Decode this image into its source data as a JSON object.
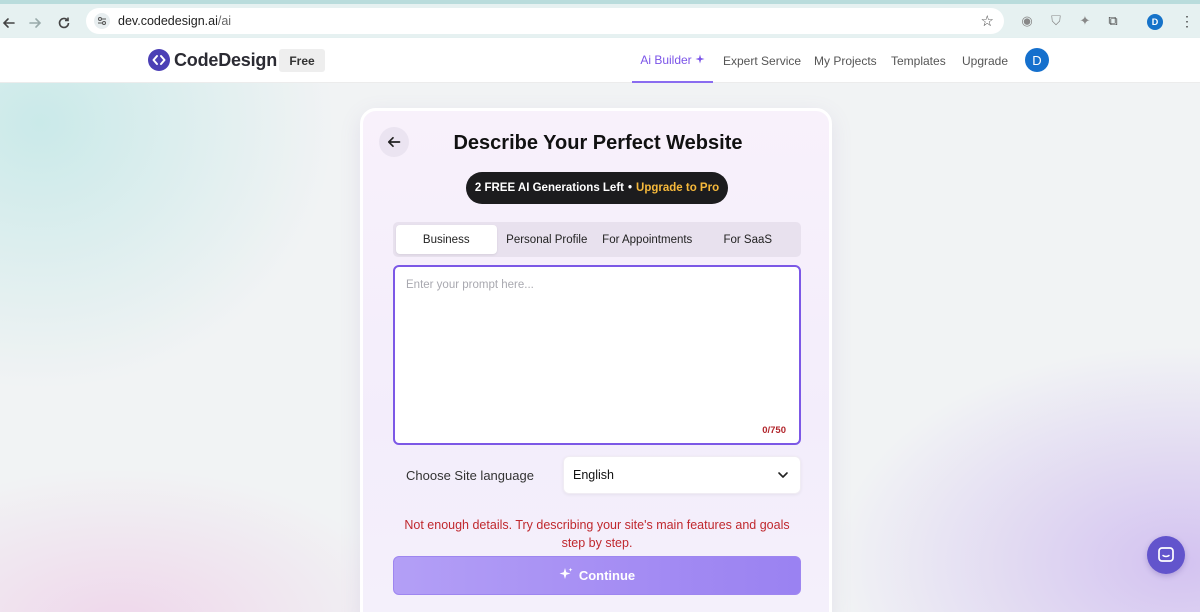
{
  "browser": {
    "url_host": "dev.codedesign.ai",
    "url_path": "/ai"
  },
  "header": {
    "brand": "CodeDesign",
    "plan_badge": "Free",
    "nav": [
      {
        "label": "Ai Builder",
        "active": true
      },
      {
        "label": "Expert Service",
        "active": false
      },
      {
        "label": "My Projects",
        "active": false
      },
      {
        "label": "Templates",
        "active": false
      },
      {
        "label": "Upgrade",
        "active": false
      }
    ],
    "avatar_initial": "D"
  },
  "card": {
    "title": "Describe Your Perfect Website",
    "generations_text": "2 FREE AI Generations Left",
    "generations_sep": "•",
    "upgrade_link": "Upgrade to Pro",
    "tabs": [
      {
        "label": "Business",
        "active": true
      },
      {
        "label": "Personal Profile",
        "active": false
      },
      {
        "label": "For Appointments",
        "active": false
      },
      {
        "label": "For SaaS",
        "active": false
      }
    ],
    "prompt": {
      "placeholder": "Enter your prompt here...",
      "value": "",
      "char_count": "0/750"
    },
    "language": {
      "label": "Choose Site language",
      "selected": "English"
    },
    "error": "Not enough details. Try describing your site's main features and goals step by step.",
    "continue_label": "Continue"
  },
  "colors": {
    "accent": "#7b54e8",
    "brand": "#4b3fb5",
    "error": "#c0282e",
    "upgrade": "#f6b93b"
  },
  "icons": {
    "chat": "chat-bubble-icon",
    "back": "arrow-left-icon",
    "sparkle": "sparkle-icon"
  }
}
